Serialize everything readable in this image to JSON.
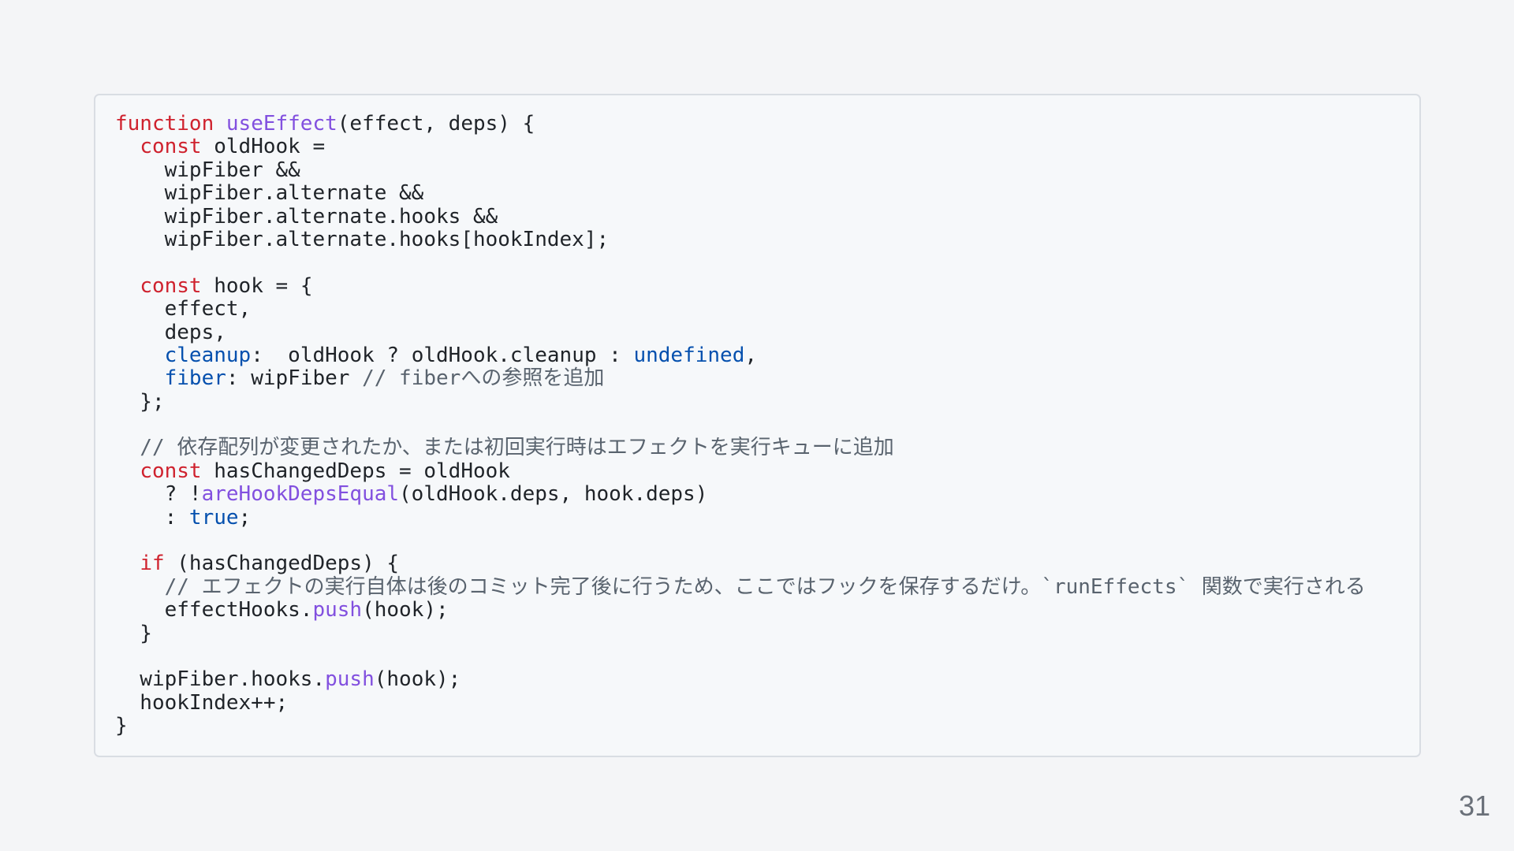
{
  "code": {
    "lines": [
      [
        {
          "t": "function",
          "c": "kw"
        },
        {
          "t": " "
        },
        {
          "t": "useEffect",
          "c": "fn"
        },
        {
          "t": "(effect, deps) {"
        }
      ],
      [
        {
          "t": "  "
        },
        {
          "t": "const",
          "c": "kw"
        },
        {
          "t": " oldHook ="
        }
      ],
      [
        {
          "t": "    wipFiber &&"
        }
      ],
      [
        {
          "t": "    wipFiber.alternate &&"
        }
      ],
      [
        {
          "t": "    wipFiber.alternate.hooks &&"
        }
      ],
      [
        {
          "t": "    wipFiber.alternate.hooks[hookIndex];"
        }
      ],
      [],
      [
        {
          "t": "  "
        },
        {
          "t": "const",
          "c": "kw"
        },
        {
          "t": " hook = {"
        }
      ],
      [
        {
          "t": "    effect,"
        }
      ],
      [
        {
          "t": "    deps,"
        }
      ],
      [
        {
          "t": "    "
        },
        {
          "t": "cleanup",
          "c": "prop"
        },
        {
          "t": ":  oldHook ? oldHook.cleanup : "
        },
        {
          "t": "undefined",
          "c": "lit"
        },
        {
          "t": ","
        }
      ],
      [
        {
          "t": "    "
        },
        {
          "t": "fiber",
          "c": "prop"
        },
        {
          "t": ": wipFiber "
        },
        {
          "t": "// fiberへの参照を追加",
          "c": "cm"
        }
      ],
      [
        {
          "t": "  };"
        }
      ],
      [],
      [
        {
          "t": "  "
        },
        {
          "t": "// 依存配列が変更されたか、または初回実行時はエフェクトを実行キューに追加",
          "c": "cm"
        }
      ],
      [
        {
          "t": "  "
        },
        {
          "t": "const",
          "c": "kw"
        },
        {
          "t": " hasChangedDeps = oldHook"
        }
      ],
      [
        {
          "t": "    ? !"
        },
        {
          "t": "areHookDepsEqual",
          "c": "fn"
        },
        {
          "t": "(oldHook.deps, hook.deps)"
        }
      ],
      [
        {
          "t": "    : "
        },
        {
          "t": "true",
          "c": "lit"
        },
        {
          "t": ";"
        }
      ],
      [],
      [
        {
          "t": "  "
        },
        {
          "t": "if",
          "c": "kw"
        },
        {
          "t": " (hasChangedDeps) {"
        }
      ],
      [
        {
          "t": "    "
        },
        {
          "t": "// エフェクトの実行自体は後のコミット完了後に行うため、ここではフックを保存するだけ。`runEffects` 関数で実行される",
          "c": "cm"
        }
      ],
      [
        {
          "t": "    effectHooks."
        },
        {
          "t": "push",
          "c": "fn"
        },
        {
          "t": "(hook);"
        }
      ],
      [
        {
          "t": "  }"
        }
      ],
      [],
      [
        {
          "t": "  wipFiber.hooks."
        },
        {
          "t": "push",
          "c": "fn"
        },
        {
          "t": "(hook);"
        }
      ],
      [
        {
          "t": "  hookIndex++;"
        }
      ],
      [
        {
          "t": "}"
        }
      ]
    ]
  },
  "page_number": "31"
}
